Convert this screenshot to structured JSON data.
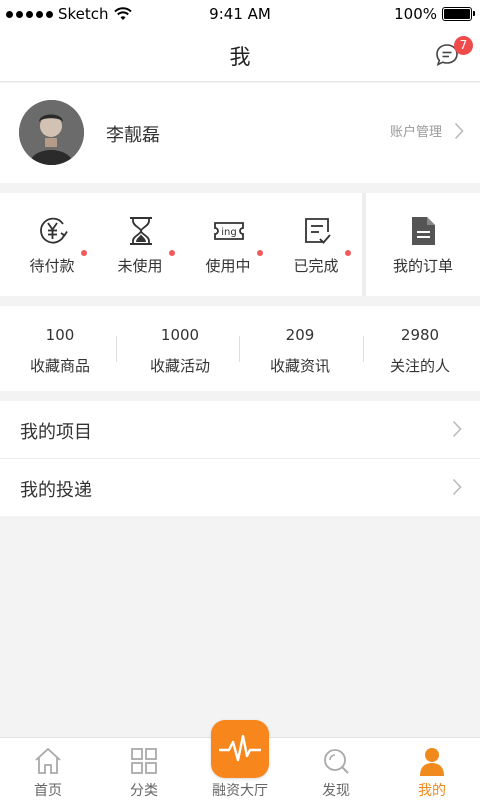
{
  "status_bar": {
    "carrier": "Sketch",
    "time": "9:41 AM",
    "battery": "100%"
  },
  "nav": {
    "title": "我",
    "message_count": "7"
  },
  "profile": {
    "name": "李靓磊",
    "account_link": "账户管理"
  },
  "orders": {
    "items": [
      {
        "label": "待付款",
        "icon": "yuan-coin-icon",
        "has_dot": true
      },
      {
        "label": "未使用",
        "icon": "hourglass-icon",
        "has_dot": true
      },
      {
        "label": "使用中",
        "icon": "ticket-icon",
        "has_dot": true
      },
      {
        "label": "已完成",
        "icon": "checklist-icon",
        "has_dot": true
      }
    ],
    "all_label": "我的订单"
  },
  "stats": [
    {
      "value": "100",
      "label": "收藏商品"
    },
    {
      "value": "1000",
      "label": "收藏活动"
    },
    {
      "value": "209",
      "label": "收藏资讯"
    },
    {
      "value": "2980",
      "label": "关注的人"
    }
  ],
  "menu": [
    {
      "label": "我的项目"
    },
    {
      "label": "我的投递"
    }
  ],
  "tabs": [
    {
      "label": "首页",
      "icon": "home-icon"
    },
    {
      "label": "分类",
      "icon": "grid-icon"
    },
    {
      "label": "融资大厅",
      "icon": "pulse-icon"
    },
    {
      "label": "发现",
      "icon": "search-icon"
    },
    {
      "label": "我的",
      "icon": "person-icon",
      "active": true
    }
  ],
  "colors": {
    "accent": "#f7861d",
    "badge": "#f04b4b",
    "dot": "#f25b5b",
    "background": "#f3f3f3"
  }
}
